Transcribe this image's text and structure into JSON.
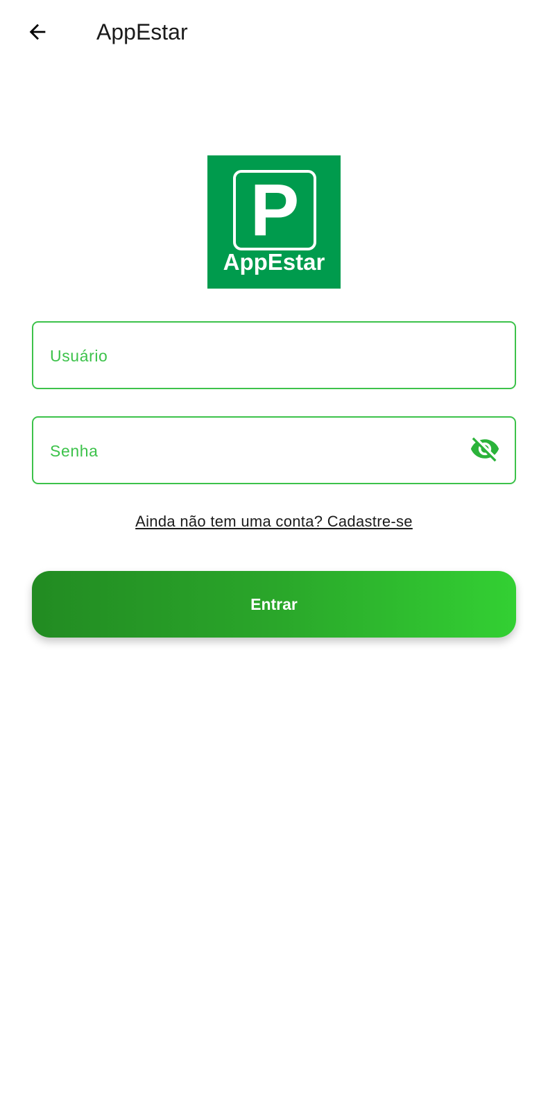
{
  "app_bar": {
    "title": "AppEstar",
    "back_icon": "arrow-left-icon"
  },
  "logo": {
    "letter": "P",
    "text": "AppEstar",
    "background_color": "#009b4d"
  },
  "form": {
    "username_placeholder": "Usuário",
    "password_placeholder": "Senha",
    "password_toggle_icon": "eye-off-icon",
    "signup_link": "Ainda não tem uma conta? Cadastre-se",
    "submit_label": "Entrar"
  },
  "colors": {
    "accent": "#3cc24a",
    "button_gradient_start": "#228b22",
    "button_gradient_end": "#33d033"
  }
}
